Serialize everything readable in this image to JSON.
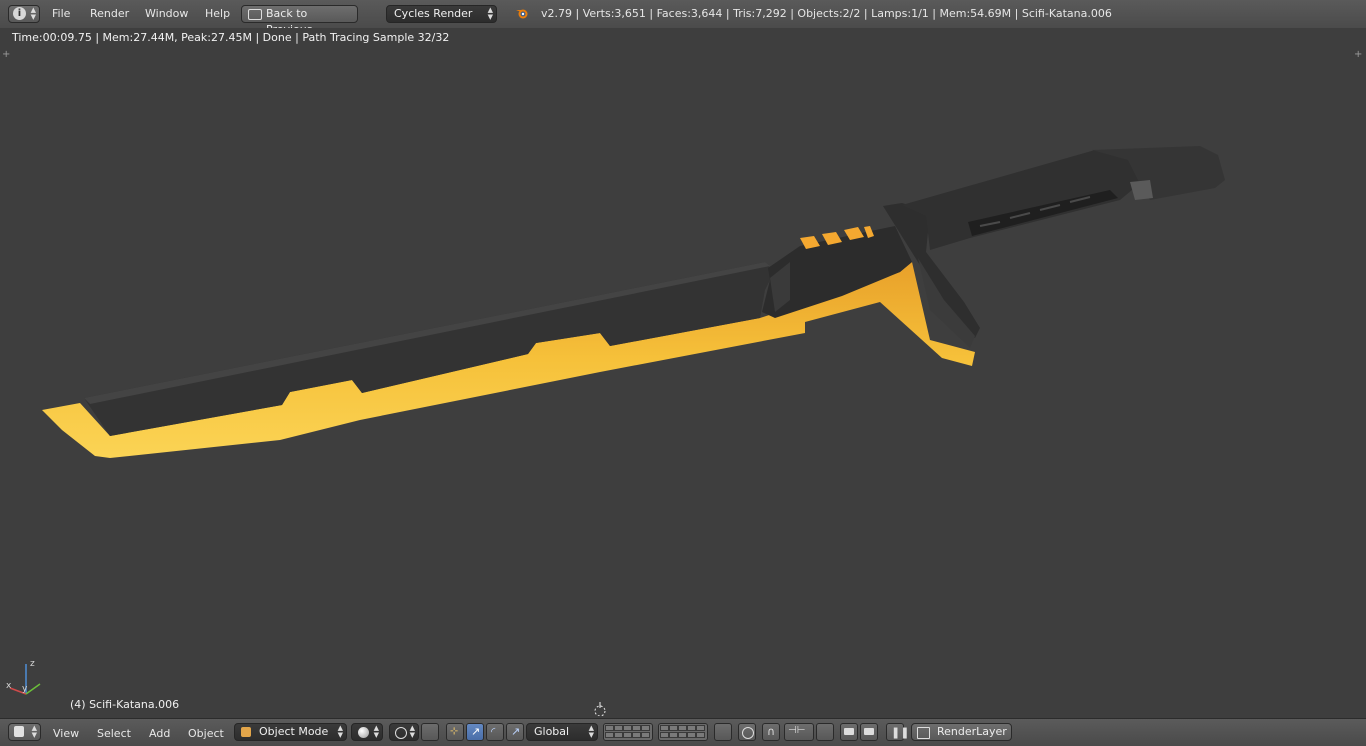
{
  "topbar": {
    "menus": [
      "File",
      "Render",
      "Window",
      "Help"
    ],
    "back_button": "Back to Previous",
    "engine": "Cycles Render",
    "stats": "v2.79 | Verts:3,651 | Faces:3,644 | Tris:7,292 | Objects:2/2 | Lamps:1/1 | Mem:54.69M | Scifi-Katana.006"
  },
  "viewport": {
    "render_info": "Time:00:09.75 | Mem:27.44M, Peak:27.45M | Done | Path Tracing Sample 32/32",
    "object_label": "(4) Scifi-Katana.006",
    "axes": {
      "x": "x",
      "y": "y",
      "z": "z"
    }
  },
  "bottombar": {
    "menus": [
      "View",
      "Select",
      "Add",
      "Object"
    ],
    "mode": "Object Mode",
    "orientation": "Global",
    "render_layer": "RenderLayer"
  },
  "colors": {
    "blade_yellow": "#f3b52c",
    "blade_dark": "#2e2e2e",
    "viewport_bg": "#3e3e3e",
    "active_blue": "#5a7fbd"
  }
}
